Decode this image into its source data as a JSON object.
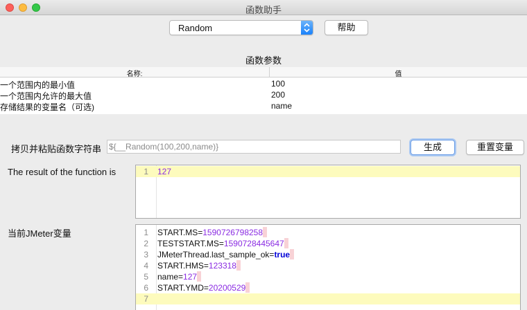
{
  "window": {
    "title": "函数助手"
  },
  "colors": {
    "close": "#fc605b",
    "minimize": "#fdbc40",
    "maximize": "#34c84a",
    "accent": "#1a82fb",
    "value": "#8a2be2",
    "keyword": "#0000d6",
    "current_line": "#fdfbbd"
  },
  "function_select": {
    "value": "Random",
    "icon": "chevron-up-down-icon"
  },
  "toolbar": {
    "help_label": "帮助"
  },
  "params": {
    "title": "函数参数",
    "columns": [
      "名称:",
      "值"
    ],
    "rows": [
      {
        "name": "一个范围内的最小值",
        "value": "100"
      },
      {
        "name": "一个范围内允许的最大值",
        "value": "200"
      },
      {
        "name": "存储结果的变量名（可选)",
        "value": "name"
      }
    ]
  },
  "copy_row": {
    "label": "拷贝并粘贴函数字符串",
    "value": "${__Random(100,200,name)}",
    "generate_label": "生成",
    "reset_label": "重置变量"
  },
  "result": {
    "label": "The result of the function is",
    "lines": [
      {
        "no": "1",
        "text": "127"
      }
    ]
  },
  "vars": {
    "label": "当前JMeter变量",
    "lines": [
      {
        "no": "1",
        "key": "START.MS",
        "eq": "=",
        "value": "1590726798258"
      },
      {
        "no": "2",
        "key": "TESTSTART.MS",
        "eq": "=",
        "value": "1590728445647"
      },
      {
        "no": "3",
        "key": "JMeterThread.last_sample_ok",
        "eq": "=",
        "value": "true"
      },
      {
        "no": "4",
        "key": "START.HMS",
        "eq": "=",
        "value": "123318"
      },
      {
        "no": "5",
        "key": "name",
        "eq": "=",
        "value": "127"
      },
      {
        "no": "6",
        "key": "START.YMD",
        "eq": "=",
        "value": "20200529"
      },
      {
        "no": "7",
        "key": "",
        "eq": "",
        "value": ""
      }
    ]
  }
}
